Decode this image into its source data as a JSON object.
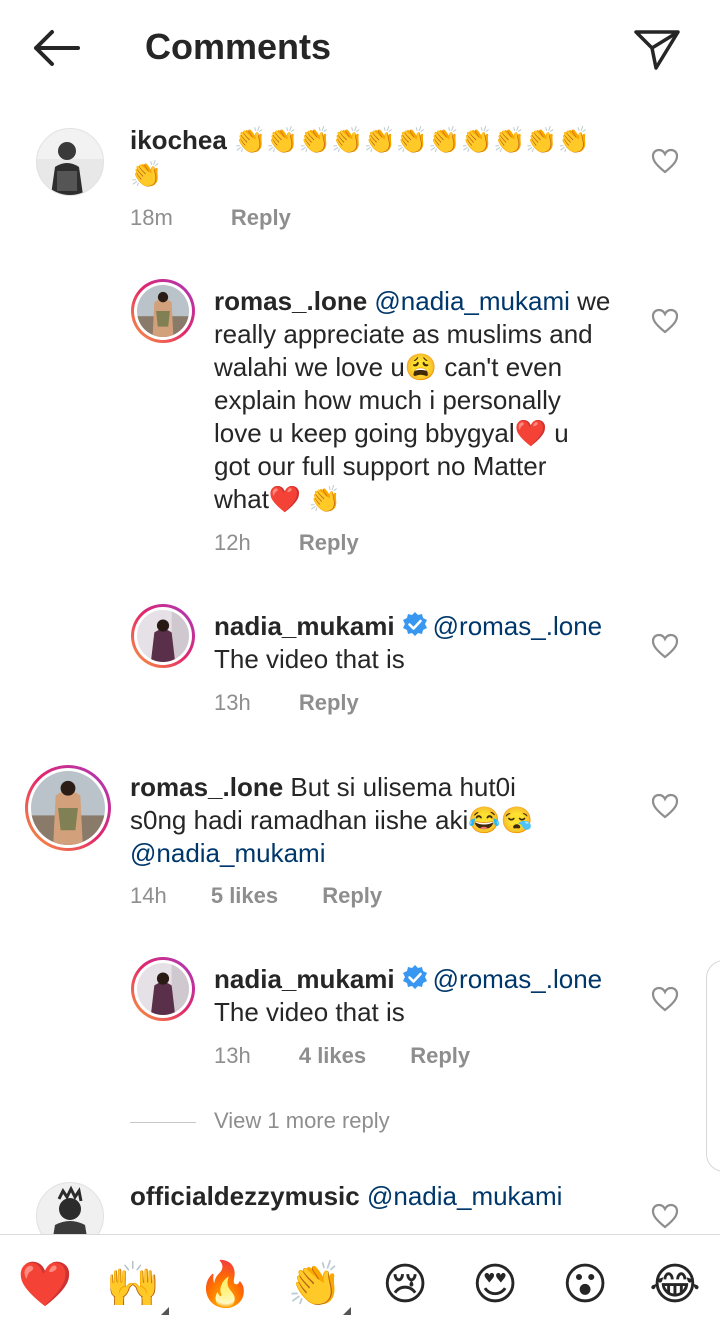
{
  "header": {
    "title": "Comments"
  },
  "comments": [
    {
      "user": "ikochea",
      "text": "",
      "emojis": "👏👏👏👏👏👏👏👏👏👏👏",
      "emojis2": "👏",
      "time": "18m",
      "reply": "Reply"
    },
    {
      "user": "romas_.lone",
      "mention": "@nadia_mukami",
      "text1": "we",
      "line2": "really appreciate as muslims and",
      "line3": "walahi we love u😩 can't even",
      "line4": "explain how much i personally",
      "line5": "love u keep going bbygyal❤️ u",
      "line6": "got our full support no Matter",
      "line7": "what❤️ 👏",
      "time": "12h",
      "reply": "Reply"
    },
    {
      "user": "nadia_mukami",
      "mention": "@romas_.lone",
      "text": "The video that is",
      "time": "13h",
      "reply": "Reply"
    },
    {
      "user": "romas_.lone",
      "line1": "But si ulisema hut0i",
      "line2": "s0ng hadi ramadhan iishe aki😂😪",
      "mention": "@nadia_mukami",
      "time": "14h",
      "likes": "5 likes",
      "reply": "Reply"
    },
    {
      "user": "nadia_mukami",
      "mention": "@romas_.lone",
      "text": "The video that is",
      "time": "13h",
      "likes": "4 likes",
      "reply": "Reply"
    },
    {
      "user": "officialdezzymusic",
      "mention": "@nadia_mukami"
    }
  ],
  "view_more": "View 1 more reply",
  "reactions": [
    "❤️",
    "🙌",
    "🔥",
    "👏",
    "😢",
    "😍",
    "😮",
    "😂"
  ],
  "colors": {
    "mention": "#00376b",
    "muted": "#8e8e8e",
    "verified": "#3897f0"
  }
}
